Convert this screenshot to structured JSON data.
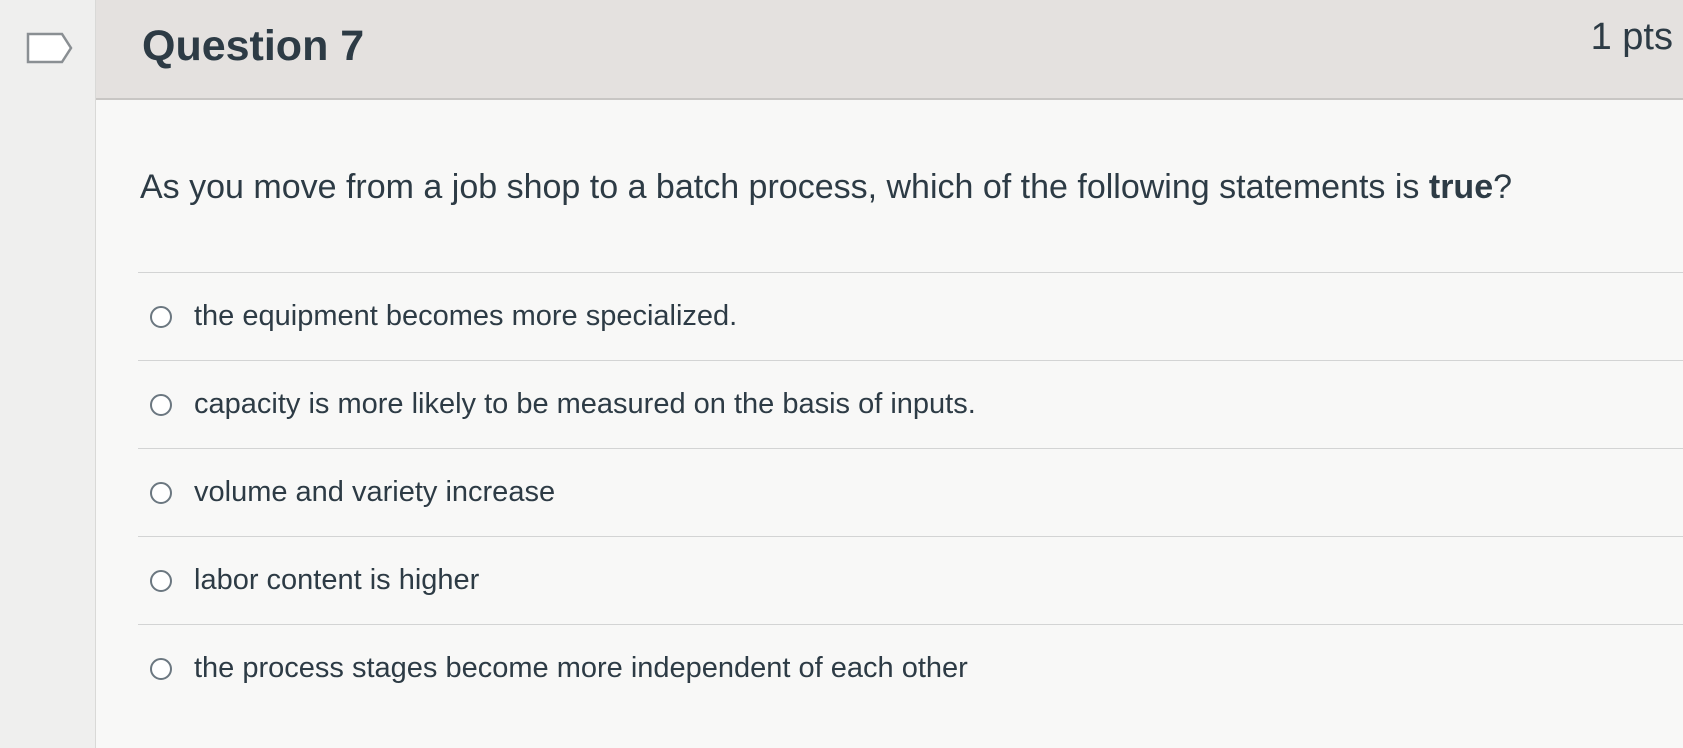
{
  "question": {
    "title": "Question 7",
    "points": "1 pts",
    "text_main": "As you move from a job shop to a batch process, which of the following statements is ",
    "text_emphasis": "true",
    "text_end": "?"
  },
  "answers": [
    {
      "label": "the equipment becomes more specialized.",
      "selected": false
    },
    {
      "label": "capacity is more likely to be measured on the basis of inputs.",
      "selected": false
    },
    {
      "label": "volume and variety increase",
      "selected": false
    },
    {
      "label": "labor content is higher",
      "selected": false
    },
    {
      "label": "the process stages become more independent of each other",
      "selected": false
    }
  ],
  "icons": {
    "flag": "flag-question-icon",
    "radio": "radio-unchecked-icon"
  },
  "colors": {
    "text": "#2d3b45",
    "header_bg": "#e4e1df",
    "divider": "#d3d4d4"
  }
}
